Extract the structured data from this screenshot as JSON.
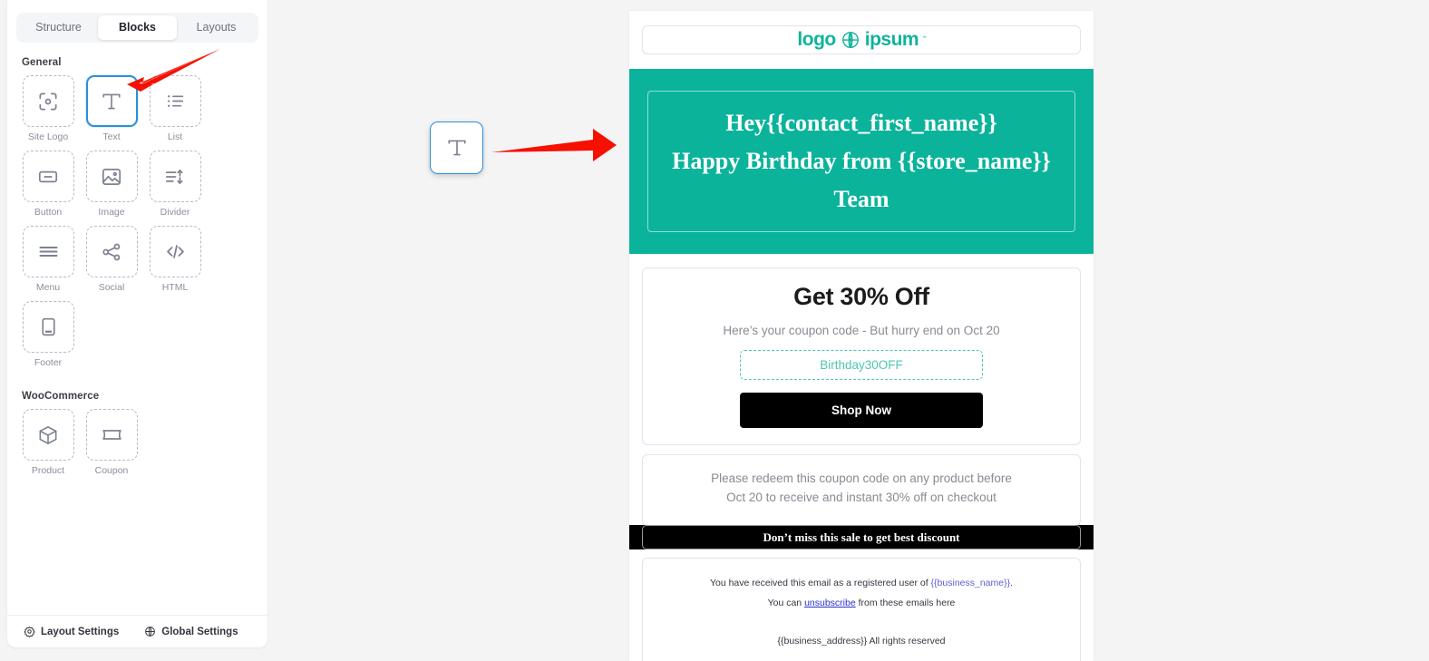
{
  "theme": {
    "accent_teal": "#0bb39b",
    "selection_blue": "#2b90d9",
    "arrow_red": "#f51000",
    "black": "#000000",
    "coupon_border": "#4dc6b2"
  },
  "sidebar": {
    "tabs": [
      {
        "label": "Structure",
        "active": false
      },
      {
        "label": "Blocks",
        "active": true
      },
      {
        "label": "Layouts",
        "active": false
      }
    ],
    "groups": [
      {
        "title": "General",
        "blocks": [
          {
            "label": "Site Logo",
            "icon": "site-logo-icon",
            "selected": false
          },
          {
            "label": "Text",
            "icon": "text-icon",
            "selected": true
          },
          {
            "label": "List",
            "icon": "list-icon",
            "selected": false
          },
          {
            "label": "Button",
            "icon": "button-icon",
            "selected": false
          },
          {
            "label": "Image",
            "icon": "image-icon",
            "selected": false
          },
          {
            "label": "Divider",
            "icon": "divider-icon",
            "selected": false
          },
          {
            "label": "Menu",
            "icon": "menu-icon",
            "selected": false
          },
          {
            "label": "Social",
            "icon": "social-share-icon",
            "selected": false
          },
          {
            "label": "HTML",
            "icon": "code-icon",
            "selected": false
          },
          {
            "label": "Footer",
            "icon": "footer-icon",
            "selected": false
          }
        ]
      },
      {
        "title": "WooCommerce",
        "blocks": [
          {
            "label": "Product",
            "icon": "product-box-icon",
            "selected": false
          },
          {
            "label": "Coupon",
            "icon": "coupon-ticket-icon",
            "selected": false
          }
        ]
      }
    ],
    "footer": {
      "layout_settings": "Layout Settings",
      "global_settings": "Global Settings"
    }
  },
  "canvas": {
    "drag_chip_icon": "text-icon",
    "annotations": [
      {
        "name": "arrow-to-text-block"
      },
      {
        "name": "arrow-to-email-hero"
      }
    ]
  },
  "email": {
    "logo": {
      "left": "logo",
      "right": "ipsum",
      "tm": "˜",
      "icon": "globe-icon"
    },
    "hero": {
      "lines": [
        "Hey{{contact_first_name}}",
        "Happy Birthday from {{store_name}}",
        "Team"
      ]
    },
    "offer": {
      "title": "Get 30% Off",
      "subtitle": "Here’s your coupon code - But hurry end on Oct 20",
      "coupon_code": "Birthday30OFF",
      "cta_label": "Shop Now"
    },
    "note": {
      "lines": [
        "Please redeem this coupon code on any product before",
        "Oct 20 to receive and instant 30% off on checkout"
      ]
    },
    "band": {
      "text": "Don’t miss this sale to get best discount"
    },
    "footer": {
      "line1_prefix": "You have received this email as a registered user of ",
      "line1_var": "{{business_name}}",
      "line1_suffix": ".",
      "line2_prefix": "You can ",
      "line2_link": "unsubscribe",
      "line2_suffix": " from these emails here",
      "line3": "{{business_address}}  All rights reserved"
    }
  }
}
